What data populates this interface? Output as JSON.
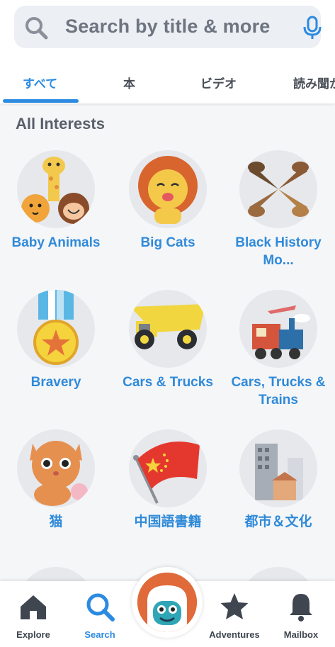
{
  "search": {
    "placeholder": "Search by title & more"
  },
  "tabs": [
    {
      "label": "すべて"
    },
    {
      "label": "本"
    },
    {
      "label": "ビデオ"
    },
    {
      "label": "読み聞か"
    }
  ],
  "section": {
    "title": "All Interests"
  },
  "interests": [
    {
      "label": "Baby Animals"
    },
    {
      "label": "Big Cats"
    },
    {
      "label": "Black History Mo..."
    },
    {
      "label": "Bravery"
    },
    {
      "label": "Cars & Trucks"
    },
    {
      "label": "Cars, Trucks & Trains"
    },
    {
      "label": "猫"
    },
    {
      "label": "中国語書籍"
    },
    {
      "label": "都市＆文化"
    }
  ],
  "nav": {
    "explore": "Explore",
    "search": "Search",
    "adventures": "Adventures",
    "mailbox": "Mailbox"
  },
  "colors": {
    "accent": "#2c8be0",
    "label": "#2f8ad9"
  }
}
